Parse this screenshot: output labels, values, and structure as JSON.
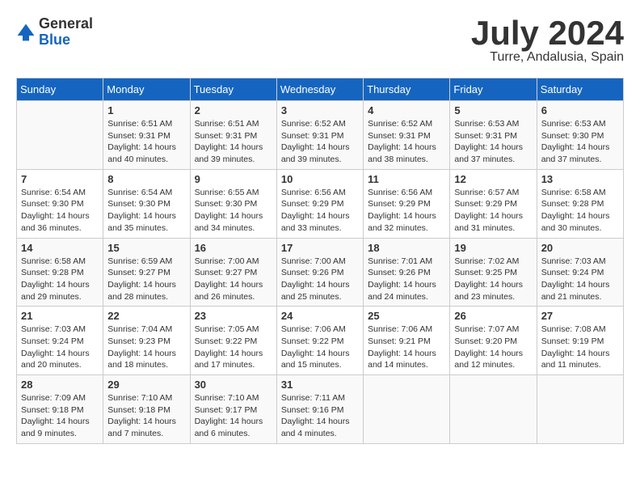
{
  "logo": {
    "general": "General",
    "blue": "Blue"
  },
  "title": "July 2024",
  "subtitle": "Turre, Andalusia, Spain",
  "days_header": [
    "Sunday",
    "Monday",
    "Tuesday",
    "Wednesday",
    "Thursday",
    "Friday",
    "Saturday"
  ],
  "weeks": [
    [
      {
        "day": "",
        "content": ""
      },
      {
        "day": "1",
        "content": "Sunrise: 6:51 AM\nSunset: 9:31 PM\nDaylight: 14 hours\nand 40 minutes."
      },
      {
        "day": "2",
        "content": "Sunrise: 6:51 AM\nSunset: 9:31 PM\nDaylight: 14 hours\nand 39 minutes."
      },
      {
        "day": "3",
        "content": "Sunrise: 6:52 AM\nSunset: 9:31 PM\nDaylight: 14 hours\nand 39 minutes."
      },
      {
        "day": "4",
        "content": "Sunrise: 6:52 AM\nSunset: 9:31 PM\nDaylight: 14 hours\nand 38 minutes."
      },
      {
        "day": "5",
        "content": "Sunrise: 6:53 AM\nSunset: 9:31 PM\nDaylight: 14 hours\nand 37 minutes."
      },
      {
        "day": "6",
        "content": "Sunrise: 6:53 AM\nSunset: 9:30 PM\nDaylight: 14 hours\nand 37 minutes."
      }
    ],
    [
      {
        "day": "7",
        "content": "Sunrise: 6:54 AM\nSunset: 9:30 PM\nDaylight: 14 hours\nand 36 minutes."
      },
      {
        "day": "8",
        "content": "Sunrise: 6:54 AM\nSunset: 9:30 PM\nDaylight: 14 hours\nand 35 minutes."
      },
      {
        "day": "9",
        "content": "Sunrise: 6:55 AM\nSunset: 9:30 PM\nDaylight: 14 hours\nand 34 minutes."
      },
      {
        "day": "10",
        "content": "Sunrise: 6:56 AM\nSunset: 9:29 PM\nDaylight: 14 hours\nand 33 minutes."
      },
      {
        "day": "11",
        "content": "Sunrise: 6:56 AM\nSunset: 9:29 PM\nDaylight: 14 hours\nand 32 minutes."
      },
      {
        "day": "12",
        "content": "Sunrise: 6:57 AM\nSunset: 9:29 PM\nDaylight: 14 hours\nand 31 minutes."
      },
      {
        "day": "13",
        "content": "Sunrise: 6:58 AM\nSunset: 9:28 PM\nDaylight: 14 hours\nand 30 minutes."
      }
    ],
    [
      {
        "day": "14",
        "content": "Sunrise: 6:58 AM\nSunset: 9:28 PM\nDaylight: 14 hours\nand 29 minutes."
      },
      {
        "day": "15",
        "content": "Sunrise: 6:59 AM\nSunset: 9:27 PM\nDaylight: 14 hours\nand 28 minutes."
      },
      {
        "day": "16",
        "content": "Sunrise: 7:00 AM\nSunset: 9:27 PM\nDaylight: 14 hours\nand 26 minutes."
      },
      {
        "day": "17",
        "content": "Sunrise: 7:00 AM\nSunset: 9:26 PM\nDaylight: 14 hours\nand 25 minutes."
      },
      {
        "day": "18",
        "content": "Sunrise: 7:01 AM\nSunset: 9:26 PM\nDaylight: 14 hours\nand 24 minutes."
      },
      {
        "day": "19",
        "content": "Sunrise: 7:02 AM\nSunset: 9:25 PM\nDaylight: 14 hours\nand 23 minutes."
      },
      {
        "day": "20",
        "content": "Sunrise: 7:03 AM\nSunset: 9:24 PM\nDaylight: 14 hours\nand 21 minutes."
      }
    ],
    [
      {
        "day": "21",
        "content": "Sunrise: 7:03 AM\nSunset: 9:24 PM\nDaylight: 14 hours\nand 20 minutes."
      },
      {
        "day": "22",
        "content": "Sunrise: 7:04 AM\nSunset: 9:23 PM\nDaylight: 14 hours\nand 18 minutes."
      },
      {
        "day": "23",
        "content": "Sunrise: 7:05 AM\nSunset: 9:22 PM\nDaylight: 14 hours\nand 17 minutes."
      },
      {
        "day": "24",
        "content": "Sunrise: 7:06 AM\nSunset: 9:22 PM\nDaylight: 14 hours\nand 15 minutes."
      },
      {
        "day": "25",
        "content": "Sunrise: 7:06 AM\nSunset: 9:21 PM\nDaylight: 14 hours\nand 14 minutes."
      },
      {
        "day": "26",
        "content": "Sunrise: 7:07 AM\nSunset: 9:20 PM\nDaylight: 14 hours\nand 12 minutes."
      },
      {
        "day": "27",
        "content": "Sunrise: 7:08 AM\nSunset: 9:19 PM\nDaylight: 14 hours\nand 11 minutes."
      }
    ],
    [
      {
        "day": "28",
        "content": "Sunrise: 7:09 AM\nSunset: 9:18 PM\nDaylight: 14 hours\nand 9 minutes."
      },
      {
        "day": "29",
        "content": "Sunrise: 7:10 AM\nSunset: 9:18 PM\nDaylight: 14 hours\nand 7 minutes."
      },
      {
        "day": "30",
        "content": "Sunrise: 7:10 AM\nSunset: 9:17 PM\nDaylight: 14 hours\nand 6 minutes."
      },
      {
        "day": "31",
        "content": "Sunrise: 7:11 AM\nSunset: 9:16 PM\nDaylight: 14 hours\nand 4 minutes."
      },
      {
        "day": "",
        "content": ""
      },
      {
        "day": "",
        "content": ""
      },
      {
        "day": "",
        "content": ""
      }
    ]
  ]
}
